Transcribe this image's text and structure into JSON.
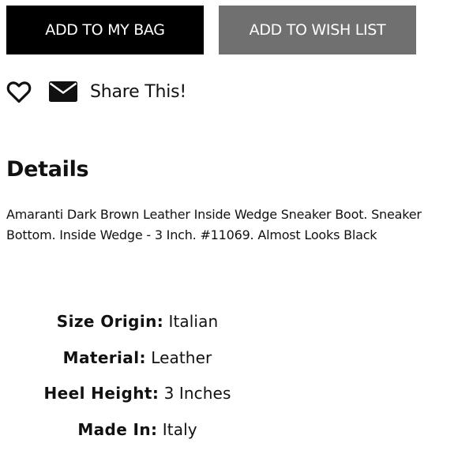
{
  "buttons": {
    "add_to_bag": "ADD TO MY BAG",
    "add_to_wishlist": "ADD TO WISH LIST"
  },
  "share": {
    "heart_icon": "heart-outline-icon",
    "mail_icon": "envelope-icon",
    "label": "Share This!"
  },
  "details": {
    "heading": "Details",
    "description": "Amaranti Dark Brown Leather Inside Wedge Sneaker Boot. Sneaker Bottom. Inside Wedge - 3 Inch. #11069. Almost Looks Black"
  },
  "specs": [
    {
      "label": "Size Origin:",
      "value": "Italian"
    },
    {
      "label": "Material:",
      "value": "Leather"
    },
    {
      "label": "Heel Height:",
      "value": "3 Inches"
    },
    {
      "label": "Made In:",
      "value": "Italy"
    }
  ],
  "colors": {
    "primary_button": "#000000",
    "secondary_button": "#707070",
    "text": "#111111"
  }
}
